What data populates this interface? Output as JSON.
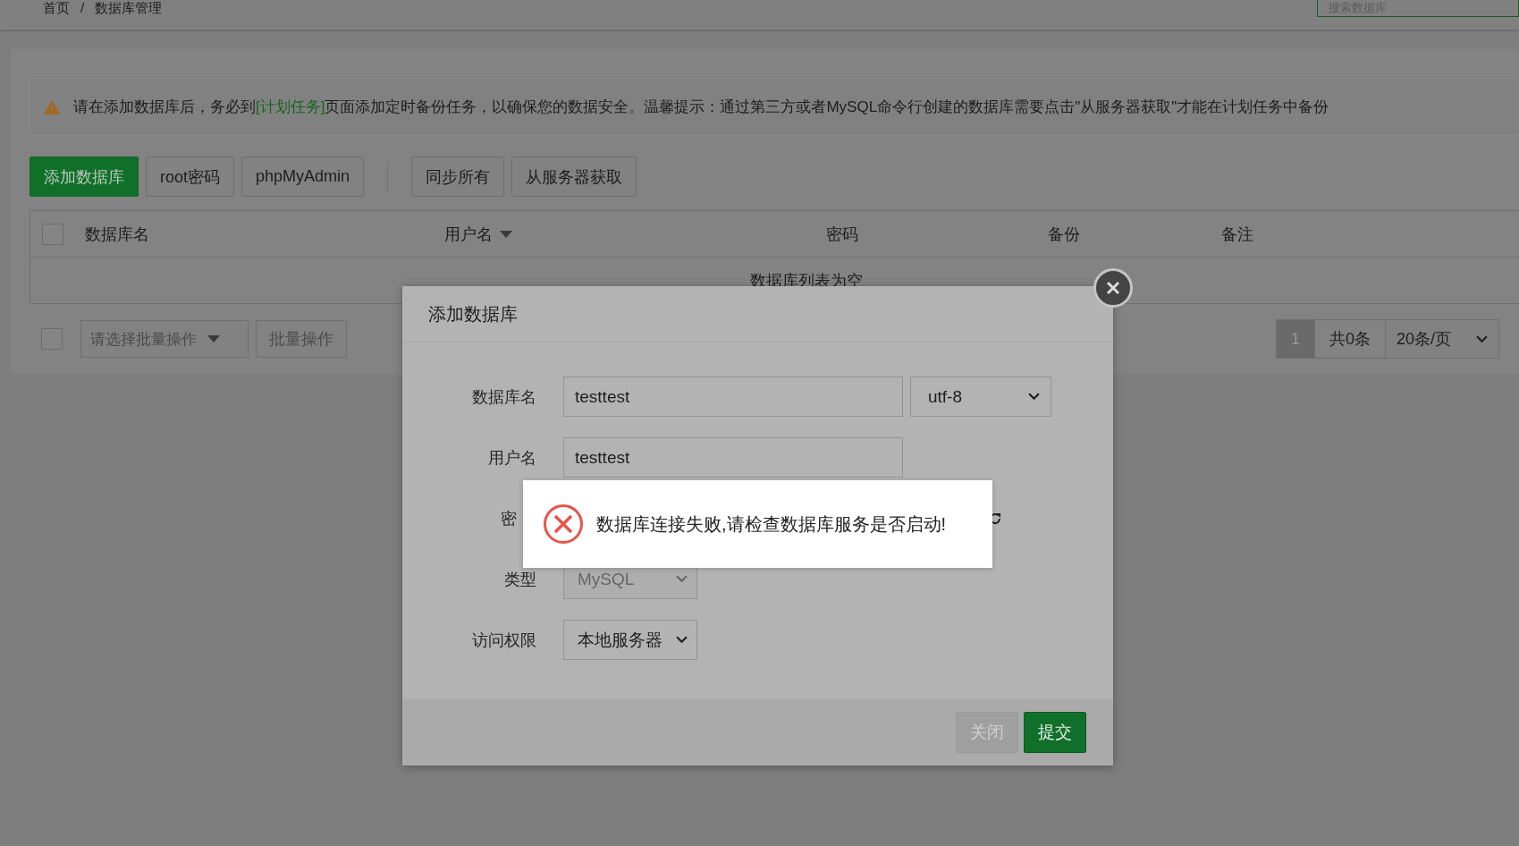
{
  "breadcrumb": {
    "items": [
      "首页",
      "数据库管理"
    ],
    "separator": "/"
  },
  "search": {
    "placeholder": "搜索数据库"
  },
  "alert": {
    "before": "请在添加数据库后，务必到",
    "link": "[计划任务]",
    "after": "页面添加定时备份任务，以确保您的数据安全。温馨提示：通过第三方或者MySQL命令行创建的数据库需要点击\"从服务器获取\"才能在计划任务中备份"
  },
  "toolbar": {
    "main": [
      {
        "label": "添加数据库",
        "kind": "primary"
      },
      {
        "label": "root密码",
        "kind": "default"
      },
      {
        "label": "phpMyAdmin",
        "kind": "default"
      }
    ],
    "sync": [
      {
        "label": "同步所有"
      },
      {
        "label": "从服务器获取"
      }
    ]
  },
  "table": {
    "select_all_checked": false,
    "columns": [
      {
        "label": "数据库名",
        "sortable": false
      },
      {
        "label": "用户名",
        "sortable": true
      },
      {
        "label": "密码",
        "sortable": false
      },
      {
        "label": "备份",
        "sortable": false
      },
      {
        "label": "备注",
        "sortable": false
      }
    ],
    "empty": "数据库列表为空"
  },
  "batch": {
    "checked": false,
    "placeholder": "请选择批量操作",
    "button": "批量操作"
  },
  "pagination": {
    "pages": [
      {
        "label": "1",
        "selected": true
      }
    ],
    "total": "共0条",
    "page_size": "20条/页"
  },
  "dialog": {
    "title": "添加数据库",
    "fields": [
      {
        "label": "数据库名",
        "kind": "input",
        "value": "testtest",
        "select": "utf-8"
      },
      {
        "label": "用户名",
        "kind": "input",
        "value": "testtest"
      },
      {
        "label": "密",
        "kind": "covered"
      },
      {
        "label": "类型",
        "kind": "select",
        "value": "MySQL",
        "disabled": true
      },
      {
        "label": "访问权限",
        "kind": "select",
        "value": "本地服务器",
        "disabled": false
      }
    ],
    "buttons": [
      {
        "label": "关闭",
        "kind": "default"
      },
      {
        "label": "提交",
        "kind": "primary"
      }
    ]
  },
  "message": {
    "kind": "error",
    "text": "数据库连接失败,请检查数据库服务是否启动!"
  }
}
